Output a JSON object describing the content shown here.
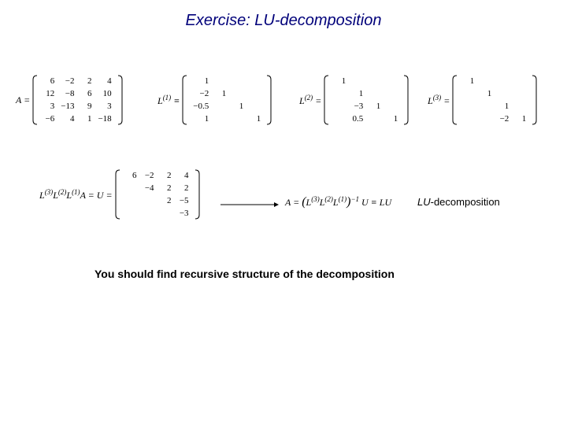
{
  "title": "Exercise: LU-decomposition",
  "A": {
    "label": "A =",
    "rows": [
      [
        "6",
        "−2",
        "2",
        "4"
      ],
      [
        "12",
        "−8",
        "6",
        "10"
      ],
      [
        "3",
        "−13",
        "9",
        "3"
      ],
      [
        "−6",
        "4",
        "1",
        "−18"
      ]
    ]
  },
  "L1": {
    "label": "L(1) ≡",
    "rows": [
      [
        "1",
        "",
        "",
        ""
      ],
      [
        "−2",
        "1",
        "",
        ""
      ],
      [
        "−0.5",
        "",
        "1",
        ""
      ],
      [
        "1",
        "",
        "",
        "1"
      ]
    ]
  },
  "L2": {
    "label": "L(2) =",
    "rows": [
      [
        "1",
        "",
        "",
        ""
      ],
      [
        "",
        "1",
        "",
        ""
      ],
      [
        "",
        "−3",
        "1",
        ""
      ],
      [
        "",
        "0.5",
        "",
        "1"
      ]
    ]
  },
  "L3": {
    "label": "L(3) =",
    "rows": [
      [
        "1",
        "",
        "",
        ""
      ],
      [
        "",
        "1",
        "",
        ""
      ],
      [
        "",
        "",
        "1",
        ""
      ],
      [
        "",
        "",
        "−2",
        "1"
      ]
    ]
  },
  "U": {
    "label": "L(3)L(2)L(1)A = U =",
    "rows": [
      [
        "6",
        "−2",
        "2",
        "4"
      ],
      [
        "",
        "−4",
        "2",
        "2"
      ],
      [
        "",
        "",
        "2",
        "−5"
      ],
      [
        "",
        "",
        "",
        "−3"
      ]
    ]
  },
  "LUeq": {
    "text": "A = (L(3)L(2)L(1))−1 U ≡ LU"
  },
  "lu_caption_prefix": "LU",
  "lu_caption_suffix": "-decomposition",
  "bottom": "You should find recursive structure of the decomposition"
}
